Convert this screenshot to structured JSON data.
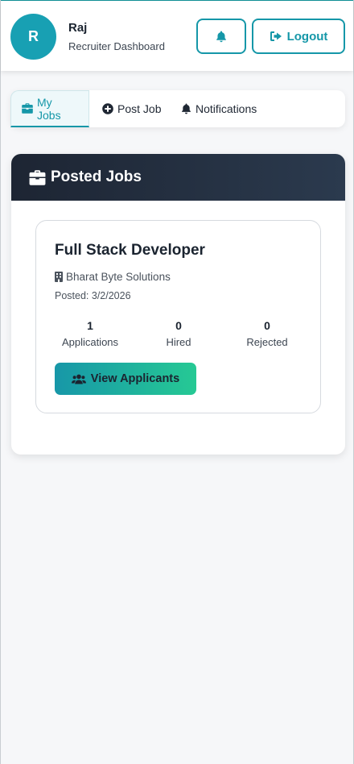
{
  "header": {
    "avatar_initial": "R",
    "user_name": "Raj",
    "user_role": "Recruiter Dashboard",
    "logout_label": "Logout"
  },
  "tabs": [
    {
      "label": "My Jobs",
      "icon": "briefcase-icon",
      "active": true
    },
    {
      "label": "Post Job",
      "icon": "plus-circle-icon",
      "active": false
    },
    {
      "label": "Notifications",
      "icon": "bell-icon",
      "active": false
    }
  ],
  "panel": {
    "title": "Posted Jobs",
    "jobs": [
      {
        "title": "Full Stack Developer",
        "company": "Bharat Byte Solutions",
        "posted": "Posted: 3/2/2026",
        "stats": [
          {
            "value": "1",
            "label": "Applications"
          },
          {
            "value": "0",
            "label": "Hired"
          },
          {
            "value": "0",
            "label": "Rejected"
          }
        ],
        "action_label": "View Applicants"
      }
    ]
  },
  "colors": {
    "accent": "#1597a8",
    "avatar": "#18a0b3",
    "panel_header": "#1d2533",
    "gradient_end": "#26c994"
  }
}
